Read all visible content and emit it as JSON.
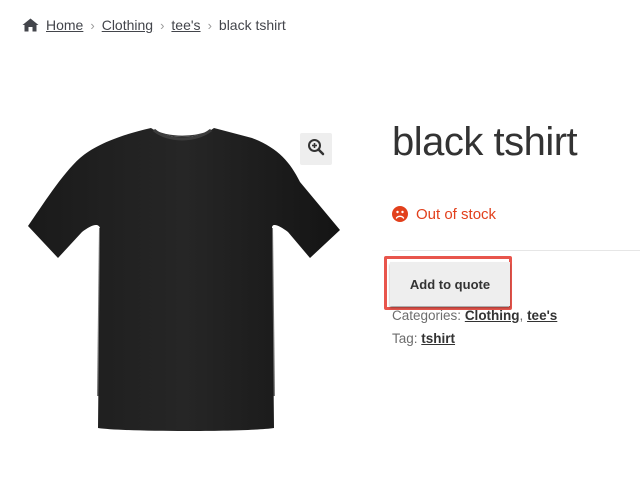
{
  "breadcrumb": {
    "icon": "home-icon",
    "items": [
      "Home",
      "Clothing",
      "tee's"
    ],
    "current": "black tshirt"
  },
  "product": {
    "title": "black tshirt",
    "stock_status": "Out of stock",
    "stock_icon": "sad-face-icon",
    "stock_color": "#e2401c",
    "zoom_icon": "zoom-in-icon",
    "image_alt": "black t-shirt",
    "add_to_quote_label": "Add to quote",
    "categories_label": "Categories:",
    "categories": [
      "Clothing",
      "tee's"
    ],
    "tag_label": "Tag:",
    "tags": [
      "tshirt"
    ]
  },
  "colors": {
    "highlight_border": "#e8554c",
    "button_bg": "#eeeeee",
    "text": "#43454b"
  }
}
